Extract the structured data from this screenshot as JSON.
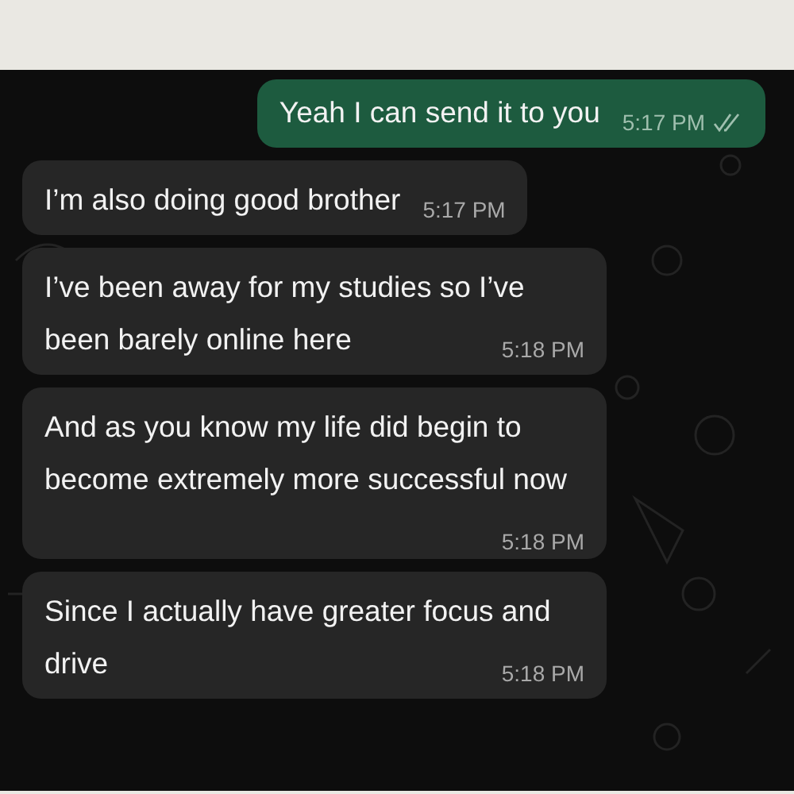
{
  "messages": [
    {
      "kind": "sent",
      "text": "Yeah I can send it to you",
      "time": "5:17 PM",
      "read": true
    },
    {
      "kind": "received",
      "text": "I’m also doing good brother",
      "time": "5:17 PM"
    },
    {
      "kind": "received",
      "text": "I’ve been away for my studies so I’ve been barely online here",
      "time": "5:18 PM"
    },
    {
      "kind": "received",
      "text": "And as you know my life did begin to become extremely more successful now",
      "time": "5:18 PM"
    },
    {
      "kind": "received",
      "text": "Since I actually have greater focus and drive",
      "time": "5:18 PM"
    }
  ]
}
